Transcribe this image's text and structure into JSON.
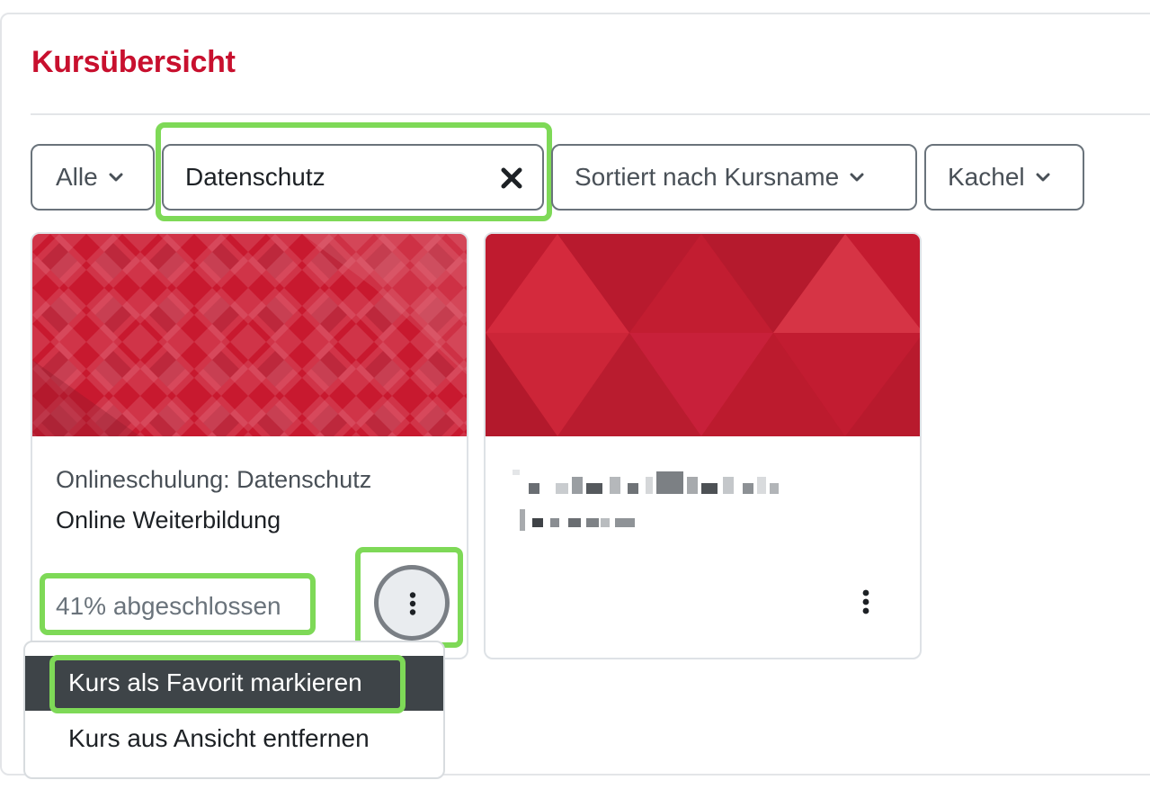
{
  "page": {
    "title": "Kursübersicht"
  },
  "filters": {
    "grouping": {
      "label": "Alle",
      "icon": "chevron-down-icon"
    },
    "search": {
      "value": "Datenschutz",
      "clear_icon": "close-icon"
    },
    "sort": {
      "label": "Sortiert nach Kursname",
      "icon": "chevron-down-icon"
    },
    "view": {
      "label": "Kachel",
      "icon": "chevron-down-icon"
    }
  },
  "courses": [
    {
      "name": "Onlineschulung: Datenschutz",
      "category": "Online Weiterbildung",
      "progress_text": "41% abgeschlossen",
      "progress_percent": 41,
      "menu_icon": "kebab-menu-icon"
    },
    {
      "name": "",
      "category": "",
      "menu_icon": "kebab-menu-icon"
    }
  ],
  "course_menu": {
    "items": [
      {
        "label": "Kurs als Favorit markieren",
        "active": true
      },
      {
        "label": "Kurs aus Ansicht entfernen",
        "active": false
      }
    ]
  },
  "colors": {
    "accent": "#c8102e",
    "highlight": "#7ed957",
    "menu_active_bg": "#3e4448"
  }
}
